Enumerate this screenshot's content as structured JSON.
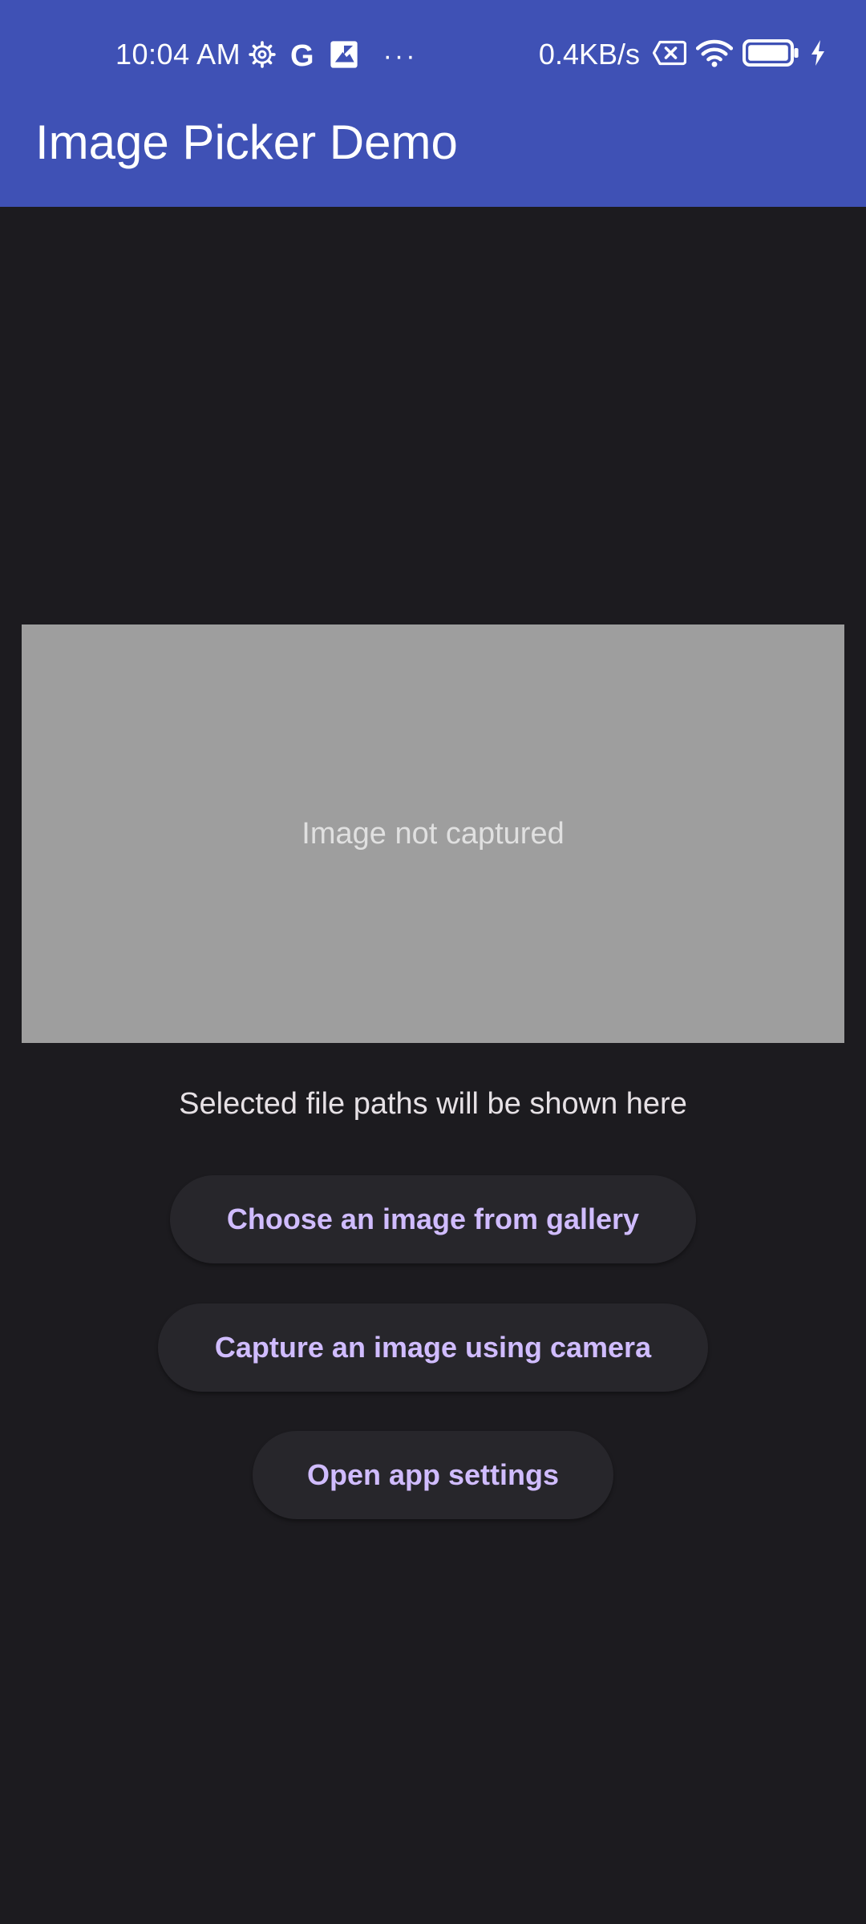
{
  "status_bar": {
    "time": "10:04 AM",
    "g_label": "G",
    "more_dots": "···",
    "net_speed": "0.4KB/s"
  },
  "app_bar": {
    "title": "Image Picker Demo",
    "color": "#3f51b5"
  },
  "preview": {
    "placeholder_text": "Image not captured"
  },
  "file_paths_text": "Selected file paths will be shown here",
  "buttons": {
    "gallery": "Choose an image from gallery",
    "camera": "Capture an image using camera",
    "settings": "Open app settings"
  },
  "colors": {
    "background": "#1c1b1f",
    "button_text": "#d0bcff",
    "button_bg": "#27262b",
    "placeholder_bg": "#9e9e9e"
  },
  "icons": [
    "settings-gear-icon",
    "google-icon",
    "photos-icon",
    "sim-no-signal-icon",
    "wifi-icon",
    "battery-icon",
    "charging-bolt-icon"
  ]
}
